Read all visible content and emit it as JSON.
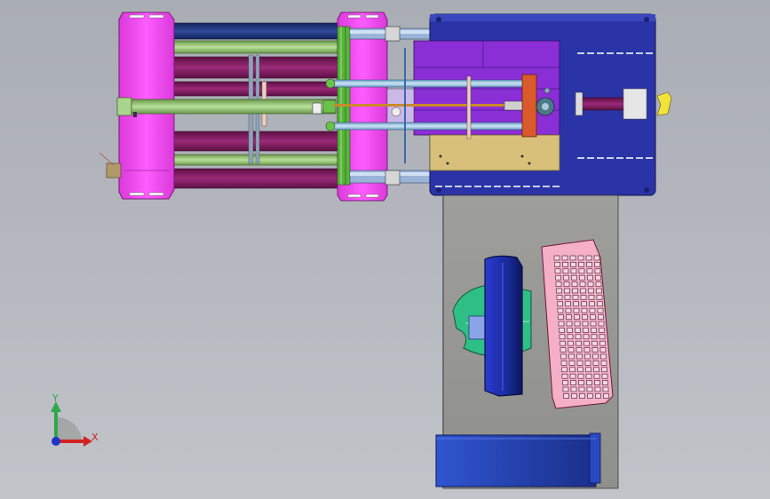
{
  "viewport": {
    "background_top": "#a9adb4",
    "background_bottom": "#c1c4c9"
  },
  "colors": {
    "frame_magenta": "#f24ff2",
    "frame_blue": "#2b34a6",
    "rod_maroon": "#7a1d5c",
    "rod_navy": "#1d2f6e",
    "rail_green": "#5fbf3a",
    "panel_purple": "#8a2ed6",
    "plate_tan": "#d8c07a",
    "table_gray": "#9b9b98",
    "monitor_blue": "#1e2ea8",
    "mousepad_green": "#2fbf86",
    "keyboard_pink": "#f5b0c8",
    "cpu_blue": "#2544b8",
    "axis_x": "#d42020",
    "axis_y": "#2fa84a",
    "axis_z": "#1f35c8"
  },
  "triad": {
    "x_label": "X",
    "y_label": "Y",
    "icons": [
      "x-axis-arrow-icon",
      "y-axis-arrow-icon",
      "z-axis-dot-icon"
    ]
  }
}
